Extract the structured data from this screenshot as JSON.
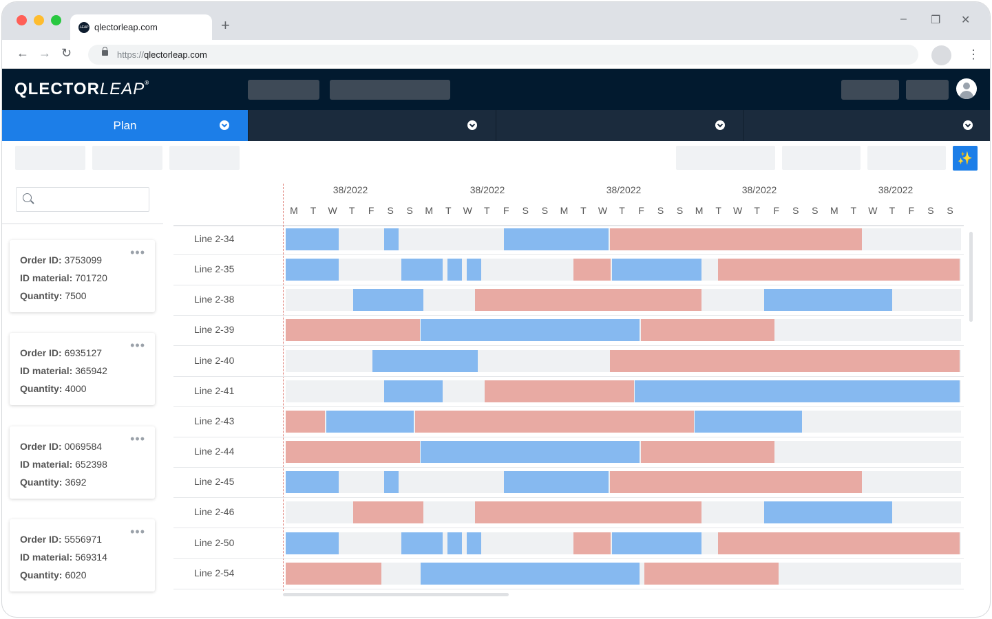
{
  "browser": {
    "tab_title": "qlectorleap.com",
    "favicon_text": "LEAP",
    "url_scheme": "https://",
    "url_host": "qlectorleap.com",
    "new_tab": "+",
    "window_controls": [
      "–",
      "❐",
      "✕"
    ],
    "nav": [
      "←",
      "→",
      "↻"
    ],
    "menu": "⋮"
  },
  "app": {
    "logo_main": "QLECTOR",
    "logo_italic": "LEAP",
    "logo_reg": "®",
    "magic_icon": "✨",
    "colors": {
      "header": "#021a2f",
      "accent": "#1c7ee8",
      "blue_bar": "#86b9f0",
      "red_bar": "#e8aaa3",
      "track": "#eff1f3"
    }
  },
  "module_tabs": [
    {
      "label": "Plan",
      "active": true
    },
    {
      "label": "",
      "active": false
    },
    {
      "label": "",
      "active": false
    },
    {
      "label": "",
      "active": false
    }
  ],
  "search": {
    "placeholder": ""
  },
  "orders": [
    {
      "more": "•••",
      "order_label": "Order ID:",
      "order_id": "3753099",
      "material_label": "ID material:",
      "material_id": "701720",
      "quantity_label": "Quantity:",
      "quantity": "7500"
    },
    {
      "more": "•••",
      "order_label": "Order ID:",
      "order_id": "6935127",
      "material_label": "ID material:",
      "material_id": "365942",
      "quantity_label": "Quantity:",
      "quantity": "4000"
    },
    {
      "more": "•••",
      "order_label": "Order ID:",
      "order_id": "0069584",
      "material_label": "ID material:",
      "material_id": "652398",
      "quantity_label": "Quantity:",
      "quantity": "3692"
    },
    {
      "more": "•••",
      "order_label": "Order ID:",
      "order_id": "5556971",
      "material_label": "ID material:",
      "material_id": "569314",
      "quantity_label": "Quantity:",
      "quantity": "6020"
    }
  ],
  "gantt": {
    "weeks": [
      "38/2022",
      "38/2022",
      "38/2022",
      "38/2022",
      "38/2022"
    ],
    "days": [
      "M",
      "T",
      "W",
      "T",
      "F",
      "S",
      "S",
      "M",
      "T",
      "W",
      "T",
      "F",
      "S",
      "S",
      "M",
      "T",
      "W",
      "T",
      "F",
      "S",
      "S",
      "M",
      "T",
      "W",
      "T",
      "F",
      "S",
      "S",
      "M",
      "T",
      "W",
      "T",
      "F",
      "S",
      "S"
    ],
    "lines": [
      {
        "name": "Line 2-34",
        "bars": [
          [
            "b",
            0,
            2.8
          ],
          [
            "b",
            5.1,
            5.9
          ],
          [
            "b",
            11.3,
            16.8
          ],
          [
            "r",
            16.8,
            29.9
          ]
        ]
      },
      {
        "name": "Line 2-35",
        "bars": [
          [
            "b",
            0,
            2.8
          ],
          [
            "b",
            6,
            8.2
          ],
          [
            "b",
            8.4,
            9.2
          ],
          [
            "b",
            9.4,
            10.2
          ],
          [
            "r",
            14.9,
            16.9
          ],
          [
            "b",
            16.9,
            21.6
          ],
          [
            "r",
            22.4,
            35
          ]
        ]
      },
      {
        "name": "Line 2-38",
        "bars": [
          [
            "b",
            3.5,
            7.2
          ],
          [
            "r",
            9.8,
            21.6
          ],
          [
            "b",
            24.8,
            31.5
          ]
        ]
      },
      {
        "name": "Line 2-39",
        "bars": [
          [
            "r",
            0,
            7
          ],
          [
            "b",
            7,
            18.4
          ],
          [
            "r",
            18.4,
            25.4
          ]
        ]
      },
      {
        "name": "Line 2-40",
        "bars": [
          [
            "b",
            4.5,
            10
          ],
          [
            "r",
            16.8,
            35
          ]
        ]
      },
      {
        "name": "Line 2-41",
        "bars": [
          [
            "b",
            5.1,
            8.2
          ],
          [
            "r",
            10.3,
            18.1
          ],
          [
            "b",
            18.1,
            35
          ]
        ]
      },
      {
        "name": "Line 2-43",
        "bars": [
          [
            "r",
            0,
            2.1
          ],
          [
            "b",
            2.1,
            6.7
          ],
          [
            "r",
            6.7,
            21.2
          ],
          [
            "b",
            21.2,
            26.8
          ]
        ]
      },
      {
        "name": "Line 2-44",
        "bars": [
          [
            "r",
            0,
            7
          ],
          [
            "b",
            7,
            18.4
          ],
          [
            "r",
            18.4,
            25.4
          ]
        ]
      },
      {
        "name": "Line 2-45",
        "bars": [
          [
            "b",
            0,
            2.8
          ],
          [
            "b",
            5.1,
            5.9
          ],
          [
            "b",
            11.3,
            16.8
          ],
          [
            "r",
            16.8,
            29.9
          ]
        ]
      },
      {
        "name": "Line 2-46",
        "bars": [
          [
            "r",
            3.5,
            7.2
          ],
          [
            "r",
            9.8,
            21.6
          ],
          [
            "b",
            24.8,
            31.5
          ]
        ]
      },
      {
        "name": "Line 2-50",
        "bars": [
          [
            "b",
            0,
            2.8
          ],
          [
            "b",
            6,
            8.2
          ],
          [
            "b",
            8.4,
            9.2
          ],
          [
            "b",
            9.4,
            10.2
          ],
          [
            "r",
            14.9,
            16.9
          ],
          [
            "b",
            16.9,
            21.6
          ],
          [
            "r",
            22.4,
            35
          ]
        ]
      },
      {
        "name": "Line 2-54",
        "bars": [
          [
            "r",
            0,
            5
          ],
          [
            "b",
            7,
            18.4
          ],
          [
            "r",
            18.6,
            25.6
          ]
        ]
      }
    ]
  }
}
